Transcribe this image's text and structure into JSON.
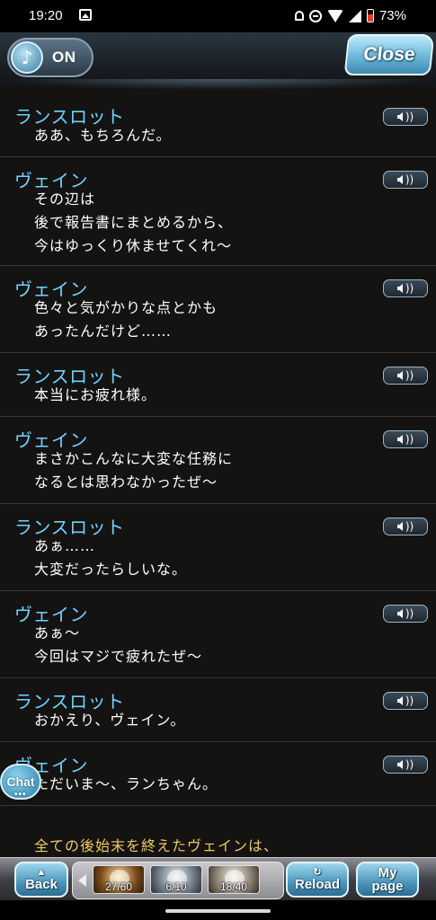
{
  "status_bar": {
    "time": "19:20",
    "battery": "73%",
    "icons": [
      "gallery-icon",
      "notifications-off-icon",
      "do-not-disturb-icon",
      "wifi-icon",
      "signal-icon",
      "battery-icon"
    ]
  },
  "header": {
    "sound_label": "ON",
    "close_label": "Close"
  },
  "log": [
    {
      "speaker": "ランスロット",
      "lines": [
        "ああ、もちろんだ。"
      ]
    },
    {
      "speaker": "ヴェイン",
      "lines": [
        "その辺は",
        "後で報告書にまとめるから、",
        "今はゆっくり休ませてくれ〜"
      ]
    },
    {
      "speaker": "ヴェイン",
      "lines": [
        "色々と気がかりな点とかも",
        "あったんだけど……"
      ]
    },
    {
      "speaker": "ランスロット",
      "lines": [
        "本当にお疲れ様。"
      ]
    },
    {
      "speaker": "ヴェイン",
      "lines": [
        "まさかこんなに大変な任務に",
        "なるとは思わなかったぜ〜"
      ]
    },
    {
      "speaker": "ランスロット",
      "lines": [
        "あぁ……",
        "大変だったらしいな。"
      ]
    },
    {
      "speaker": "ヴェイン",
      "lines": [
        "あぁ〜",
        "今回はマジで疲れたぜ〜"
      ]
    },
    {
      "speaker": "ランスロット",
      "lines": [
        "おかえり、ヴェイン。"
      ]
    },
    {
      "speaker": "ヴェイン",
      "lines": [
        "ただいま〜、ランちゃん。"
      ]
    }
  ],
  "narration": "全ての後始末を終えたヴェインは、",
  "chat_label": "Chat",
  "bottom_bar": {
    "back_label": "Back",
    "reload_label": "Reload",
    "mypage_top": "My",
    "mypage_bottom": "page",
    "items": [
      "27/60",
      "6/10",
      "18/40"
    ]
  },
  "colors": {
    "speaker": "#6fd3ff",
    "narration": "#f0c866",
    "background": "#141312"
  }
}
